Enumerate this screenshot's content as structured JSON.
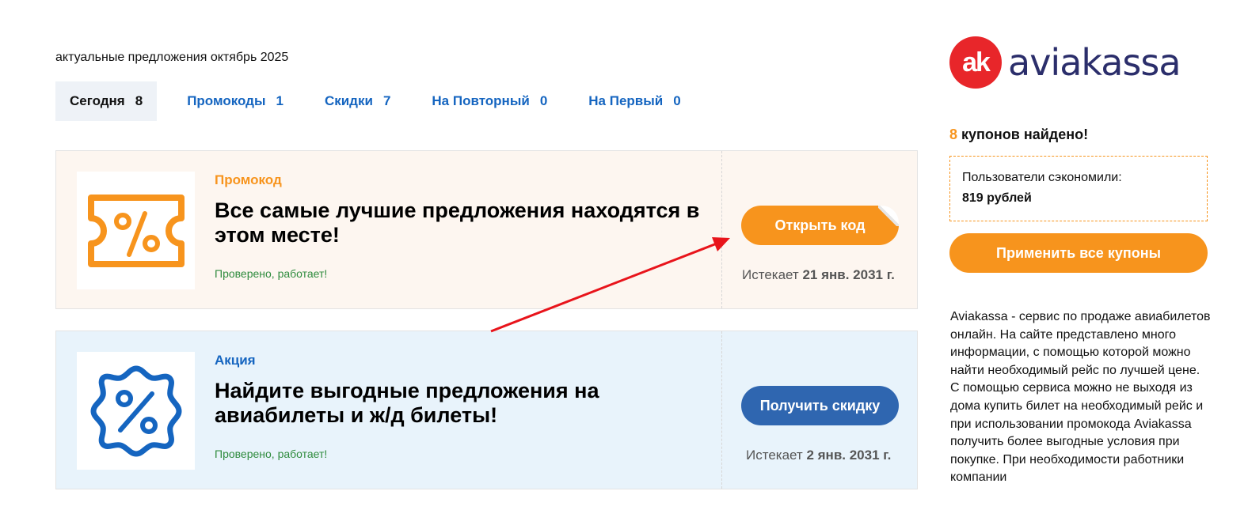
{
  "subtitle": "актуальные предложения октябрь 2025",
  "tabs": [
    {
      "label": "Сегодня",
      "count": "8"
    },
    {
      "label": "Промокоды",
      "count": "1"
    },
    {
      "label": "Скидки",
      "count": "7"
    },
    {
      "label": "На Повторный",
      "count": "0"
    },
    {
      "label": "На Первый",
      "count": "0"
    }
  ],
  "offers": [
    {
      "type": "Промокод",
      "title": "Все самые лучшие предложения находятся в этом месте!",
      "verified": "Проверено, работает!",
      "button": "Открыть код",
      "expires_label": "Истекает",
      "expires_date": "21 янв. 2031 г.",
      "icon": "ticket-percent-icon"
    },
    {
      "type": "Акция",
      "title": "Найдите выгодные предложения на авиабилеты и ж/д билеты!",
      "verified": "Проверено, работает!",
      "button": "Получить скидку",
      "expires_label": "Истекает",
      "expires_date": "2 янв. 2031 г.",
      "icon": "badge-percent-icon"
    }
  ],
  "sidebar": {
    "logo_mark": "ak",
    "logo_text": "aviakassa",
    "found_count": "8",
    "found_text": "купонов найдено!",
    "saved_label": "Пользователи сэкономили:",
    "saved_amount": "819 рублей",
    "apply_button": "Применить все купоны",
    "about": "Aviakassa - сервис по продаже авиабилетов онлайн. На сайте представлено много информации, с помощью которой можно найти необходимый рейс по лучшей цене. С помощью сервиса можно не выходя из дома купить билет на необходимый рейс и при использовании промокода Aviakassa получить более выгодные условия при покупке. При необходимости работники компании"
  },
  "colors": {
    "orange": "#f7941d",
    "blue": "#1565c0",
    "button_blue": "#2f66b0",
    "green": "#2e8b3d",
    "arrow_red": "#e8141b"
  }
}
